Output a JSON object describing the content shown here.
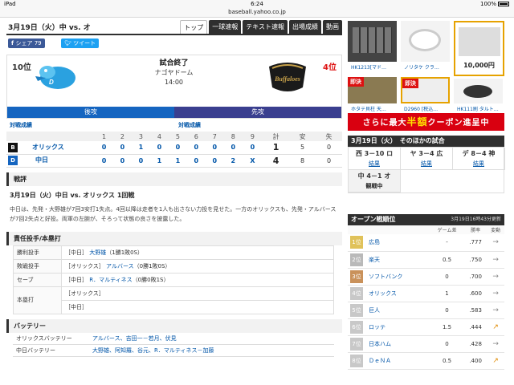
{
  "status_bar": {
    "left": "iPad",
    "time": "6:24",
    "battery": "100%"
  },
  "url": "baseball.yahoo.co.jp",
  "header": {
    "date_matchup": "3月19日（火）中 vs. オ",
    "tabs": [
      "トップ",
      "一球速報",
      "テキスト速報",
      "出場成績",
      "動画"
    ],
    "active_tab": "トップ"
  },
  "share": {
    "facebook": "シェア 79",
    "twitter": "ツイート"
  },
  "game": {
    "home_rank": "10位",
    "away_rank": "4位",
    "status": "試合終了",
    "venue": "ナゴヤドーム",
    "time": "14:00",
    "home_label": "後攻",
    "away_label": "先攻",
    "home_link": "対戦成績",
    "away_link": "対戦成績",
    "home_color": "#1565c0",
    "away_color": "#3a3f8f",
    "away_logo_text": "Buffaloes"
  },
  "linescore": {
    "headers": [
      "",
      "1",
      "2",
      "3",
      "4",
      "5",
      "6",
      "7",
      "8",
      "9",
      "計",
      "安",
      "失"
    ],
    "rows": [
      {
        "team": "オリックス",
        "cells": [
          "0",
          "0",
          "1",
          "0",
          "0",
          "0",
          "0",
          "0",
          "0",
          "1",
          "5",
          "0"
        ]
      },
      {
        "team": "中日",
        "cells": [
          "0",
          "0",
          "0",
          "1",
          "1",
          "0",
          "0",
          "2",
          "X",
          "4",
          "8",
          "0"
        ]
      }
    ]
  },
  "recap": {
    "section": "戦評",
    "headline": "3月19日（火）中日 vs. オリックス 1回戦",
    "text": "中日は、先発・大野雄が7回3安打1失点。4回以降は走者を1人も出さない力投を見せた。一方のオリックスも、先発・アルバースが7回2失点と好投。両軍の左腕が、そろって状態の良さを披露した。"
  },
  "pitchers": {
    "section": "責任投手/本塁打",
    "rows": [
      {
        "label": "勝利投手",
        "team": "［中日］",
        "name": "大野雄",
        "record": "（1勝1敗0S）"
      },
      {
        "label": "敗戦投手",
        "team": "［オリックス］",
        "name": "アルバース",
        "record": "（0勝1敗0S）"
      },
      {
        "label": "セーブ",
        "team": "［中日］",
        "name": "R．マルティネス",
        "record": "（0勝0敗1S）"
      },
      {
        "label": "本塁打",
        "team": "［オリックス］",
        "name": "",
        "record": ""
      },
      {
        "label": "",
        "team": "［中日］",
        "name": "",
        "record": ""
      }
    ]
  },
  "battery": {
    "section": "バッテリー",
    "rows": [
      {
        "label": "オリックスバッテリー",
        "value": "アルバース、吉田一－若月、伏見"
      },
      {
        "label": "中日バッテリー",
        "value": "大野雄、阿知羅、谷元、R．マルティネス－加藤"
      }
    ]
  },
  "ads": {
    "items": [
      {
        "caption": "HK1213[マド…"
      },
      {
        "caption": "ノリタケ クラ…"
      },
      {
        "caption": "HK111l5"
      },
      {
        "caption": "ホタテ貝柱 天…",
        "badge": "即決"
      },
      {
        "caption": "D2960 [税込…",
        "badge": "即決"
      },
      {
        "caption": "HK111刷 タルト…"
      }
    ],
    "featured_price": "10,000円",
    "banner_text": "さらに最大",
    "banner_highlight": "半額",
    "banner_text2": "クーポン進呈中"
  },
  "other_games": {
    "title": "3月19日（火）　そのほかの試合",
    "games": [
      {
        "score": "西 3－10 ロ",
        "result": "結果"
      },
      {
        "score": "ヤ 3－4 広",
        "result": "結果"
      },
      {
        "score": "デ 8－4 神",
        "result": "結果"
      },
      {
        "score": "中 4－1 オ",
        "result": "観戦中"
      }
    ]
  },
  "standings": {
    "title": "オープン戦順位",
    "updated": "3月19日16時43分更新",
    "headers": [
      "",
      "",
      "ゲーム差",
      "勝率",
      "変動"
    ],
    "rows": [
      {
        "rank": "1位",
        "team": "広島",
        "gb": "-",
        "pct": ".777",
        "trend": "→"
      },
      {
        "rank": "2位",
        "team": "楽天",
        "gb": "0.5",
        "pct": ".750",
        "trend": "→"
      },
      {
        "rank": "3位",
        "team": "ソフトバンク",
        "gb": "0",
        "pct": ".700",
        "trend": "→"
      },
      {
        "rank": "4位",
        "team": "オリックス",
        "gb": "1",
        "pct": ".600",
        "trend": "→"
      },
      {
        "rank": "5位",
        "team": "巨人",
        "gb": "0",
        "pct": ".583",
        "trend": "→"
      },
      {
        "rank": "6位",
        "team": "ロッテ",
        "gb": "1.5",
        "pct": ".444",
        "trend": "↗"
      },
      {
        "rank": "7位",
        "team": "日本ハム",
        "gb": "0",
        "pct": ".428",
        "trend": "→"
      },
      {
        "rank": "8位",
        "team": "ＤｅＮＡ",
        "gb": "0.5",
        "pct": ".400",
        "trend": "↗"
      }
    ],
    "rank_colors": [
      "#e0c25a",
      "#b9b9b9",
      "#c9915a",
      "#c8c8c8"
    ]
  }
}
